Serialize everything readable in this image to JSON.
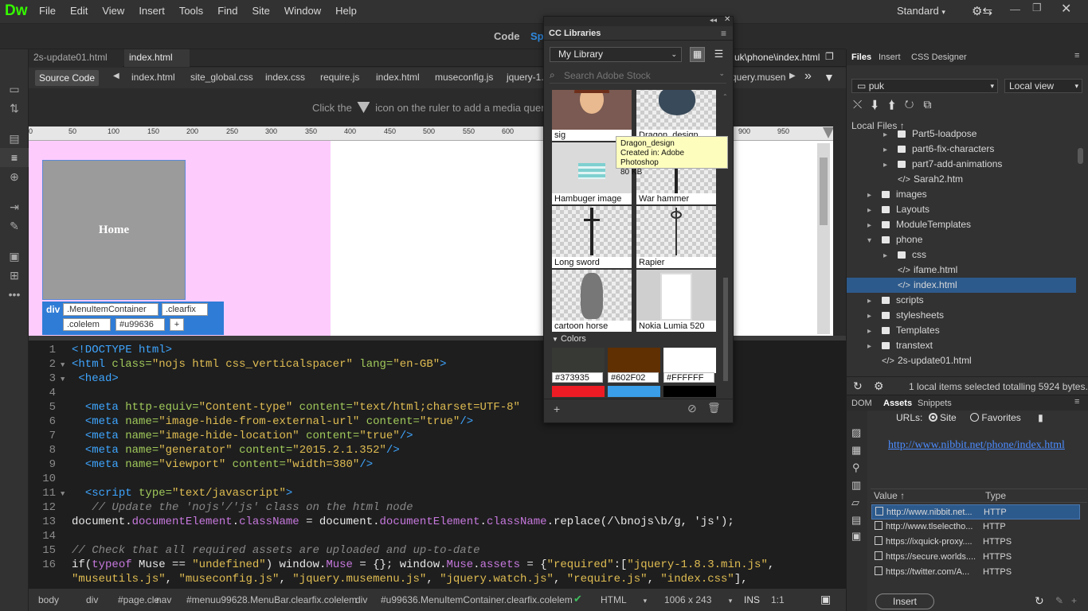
{
  "app": {
    "logo": "Dw",
    "workspace": "Standard"
  },
  "menu": [
    "File",
    "Edit",
    "View",
    "Insert",
    "Tools",
    "Find",
    "Site",
    "Window",
    "Help"
  ],
  "view_modes": {
    "code": "Code",
    "split": "Sp"
  },
  "doc_tabs": [
    {
      "label": "2s-update01.html"
    },
    {
      "label": "index.html"
    }
  ],
  "doc_path": "uk\\phone\\index.html",
  "related_files": {
    "source": "Source Code",
    "files": [
      "index.html",
      "site_global.css",
      "index.css",
      "require.js",
      "index.html",
      "museconfig.js",
      "jquery-1.",
      "query.musen"
    ]
  },
  "mq_hint": {
    "before": "Click the",
    "after": "icon on the ruler to add a media query"
  },
  "ruler_labels": [
    "0",
    "50",
    "100",
    "150",
    "200",
    "250",
    "300",
    "350",
    "400",
    "450",
    "500",
    "550",
    "600",
    "900",
    "950"
  ],
  "design": {
    "home_label": "Home",
    "tag": "div",
    "classes": [
      ".MenuItemContainer",
      ".clearfix",
      ".colelem",
      "#u99636"
    ],
    "add": "+"
  },
  "code_lines": [
    {
      "n": "1",
      "fold": false
    },
    {
      "n": "2",
      "fold": true
    },
    {
      "n": "3",
      "fold": true
    },
    {
      "n": "4",
      "fold": false
    },
    {
      "n": "5",
      "fold": false
    },
    {
      "n": "6",
      "fold": false
    },
    {
      "n": "7",
      "fold": false
    },
    {
      "n": "8",
      "fold": false
    },
    {
      "n": "9",
      "fold": false
    },
    {
      "n": "10",
      "fold": false
    },
    {
      "n": "11",
      "fold": true
    },
    {
      "n": "12",
      "fold": false
    },
    {
      "n": "13",
      "fold": false
    },
    {
      "n": "14",
      "fold": false
    },
    {
      "n": "15",
      "fold": false
    },
    {
      "n": "16",
      "fold": false
    },
    {
      "n": "",
      "fold": false
    }
  ],
  "code": {
    "l1": "<!DOCTYPE html>",
    "l2a": "<html ",
    "l2b": "class=",
    "l2c": "\"nojs html css_verticalspacer\"",
    "l2d": " lang=",
    "l2e": "\"en-GB\"",
    "l2f": ">",
    "l3": "<head>",
    "l5a": "<meta ",
    "l5b": "http-equiv=",
    "l5c": "\"Content-type\"",
    "l5d": " content=",
    "l5e": "\"text/html;charset=UTF-8\"",
    "l6a": "<meta ",
    "l6b": "name=",
    "l6c": "\"image-hide-from-external-url\"",
    "l6d": " content=",
    "l6e": "\"true\"",
    "l6f": "/>",
    "l7a": "<meta ",
    "l7b": "name=",
    "l7c": "\"image-hide-location\"",
    "l7d": " content=",
    "l7e": "\"true\"",
    "l7f": "/>",
    "l8a": "<meta ",
    "l8b": "name=",
    "l8c": "\"generator\"",
    "l8d": " content=",
    "l8e": "\"2015.2.1.352\"",
    "l8f": "/>",
    "l9a": "<meta ",
    "l9b": "name=",
    "l9c": "\"viewport\"",
    "l9d": " content=",
    "l9e": "\"width=380\"",
    "l9f": "/>",
    "l11a": "<script ",
    "l11b": "type=",
    "l11c": "\"text/javascript\"",
    "l11d": ">",
    "l12": "// Update the 'nojs'/'js' class on the html node",
    "l13a": "document.",
    "l13b": "documentElement",
    "l13c": ".",
    "l13d": "className",
    "l13e": " = document.",
    "l13f": "documentElement",
    "l13g": ".",
    "l13h": "className",
    "l13i": ".replace(/\\bnojs\\b/g, 'js');",
    "l15": "// Check that all required assets are uploaded and up-to-date",
    "l16a": "if(",
    "l16b": "typeof",
    "l16c": " Muse == ",
    "l16d": "\"undefined\"",
    "l16e": ") window.",
    "l16f": "Muse",
    "l16g": " = {}; window.",
    "l16h": "Muse",
    "l16i": ".",
    "l16j": "assets",
    "l16k": " = {",
    "l16l": "\"required\"",
    "l16m": ":[",
    "l16n": "\"jquery-1.8.3.min.js\"",
    "l16o": ",",
    "l17a": "\"museutils.js\"",
    "l17b": ", ",
    "l17c": "\"museconfig.js\"",
    "l17d": ", ",
    "l17e": "\"jquery.musemenu.js\"",
    "l17f": ", ",
    "l17g": "\"jquery.watch.js\"",
    "l17h": ", ",
    "l17i": "\"require.js\"",
    "l17j": ", ",
    "l17k": "\"index.css\"",
    "l17l": "],"
  },
  "statusbar": {
    "crumbs": [
      "body",
      "div",
      "#page.cle",
      "nav",
      "#menuu99628.MenuBar.clearfix.colelem",
      "div",
      "#u99636.MenuItemContainer.clearfix.colelem"
    ],
    "lang": "HTML",
    "size": "1006 x 243",
    "ins": "INS",
    "pos": "1:1"
  },
  "cclib": {
    "title": "CC Libraries",
    "library": "My Library",
    "search_placeholder": "Search Adobe Stock",
    "items": [
      {
        "label": "sig"
      },
      {
        "label": "Dragon_design"
      },
      {
        "label": "Hambuger image"
      },
      {
        "label": "War hammer"
      },
      {
        "label": "Long sword"
      },
      {
        "label": "Rapier"
      },
      {
        "label": "cartoon horse"
      },
      {
        "label": "Nokia Lumia 520"
      }
    ],
    "colors_heading": "Colors",
    "colors": [
      {
        "hex": "#373935",
        "color": "#373935"
      },
      {
        "hex": "#602F02",
        "color": "#602F02"
      },
      {
        "hex": "#FFFFFF",
        "color": "#FFFFFF"
      }
    ],
    "colors_row2": [
      "#ed1c24",
      "#3a9ee8",
      "#000000"
    ],
    "tooltip": {
      "name": "Dragon_design",
      "created": "Created in: Adobe Photoshop",
      "size": "80 KB"
    }
  },
  "files_panel": {
    "tabs": [
      "Files",
      "Insert",
      "CSS Designer"
    ],
    "site": "puk",
    "view": "Local view",
    "local_files": "Local Files",
    "tree": [
      {
        "label": "Part5-loadpose",
        "type": "folder",
        "indent": 2,
        "arrow": "▸"
      },
      {
        "label": "part6-fix-characters",
        "type": "folder",
        "indent": 2,
        "arrow": "▸"
      },
      {
        "label": "part7-add-animations",
        "type": "folder",
        "indent": 2,
        "arrow": "▸"
      },
      {
        "label": "Sarah2.htm",
        "type": "file",
        "indent": 2,
        "arrow": ""
      },
      {
        "label": "images",
        "type": "folder",
        "indent": 1,
        "arrow": "▸"
      },
      {
        "label": "Layouts",
        "type": "folder",
        "indent": 1,
        "arrow": "▸"
      },
      {
        "label": "ModuleTemplates",
        "type": "folder",
        "indent": 1,
        "arrow": "▸"
      },
      {
        "label": "phone",
        "type": "folder",
        "indent": 1,
        "arrow": "▾"
      },
      {
        "label": "css",
        "type": "folder",
        "indent": 2,
        "arrow": "▸"
      },
      {
        "label": "ifame.html",
        "type": "file",
        "indent": 2,
        "arrow": ""
      },
      {
        "label": "index.html",
        "type": "file",
        "indent": 2,
        "arrow": ""
      },
      {
        "label": "scripts",
        "type": "folder",
        "indent": 1,
        "arrow": "▸"
      },
      {
        "label": "stylesheets",
        "type": "folder",
        "indent": 1,
        "arrow": "▸"
      },
      {
        "label": "Templates",
        "type": "folder",
        "indent": 1,
        "arrow": "▸"
      },
      {
        "label": "transtext",
        "type": "folder",
        "indent": 1,
        "arrow": "▸"
      },
      {
        "label": "2s-update01.html",
        "type": "file",
        "indent": 1,
        "arrow": ""
      }
    ],
    "status": "1 local items selected totalling 5924 bytes."
  },
  "assets_panel": {
    "tabs": [
      "DOM",
      "Assets",
      "Snippets"
    ],
    "urls_label": "URLs:",
    "site_radio": "Site",
    "fav_radio": "Favorites",
    "preview_url": "http://www.nibbit.net/phone/index.html",
    "col_value": "Value",
    "col_type": "Type",
    "rows": [
      {
        "value": "http://www.nibbit.net...",
        "type": "HTTP"
      },
      {
        "value": "http://www.tlselectho...",
        "type": "HTTP"
      },
      {
        "value": "https://ixquick-proxy....",
        "type": "HTTPS"
      },
      {
        "value": "https://secure.worlds....",
        "type": "HTTPS"
      },
      {
        "value": "https://twitter.com/A...",
        "type": "HTTPS"
      }
    ],
    "insert_btn": "Insert"
  }
}
